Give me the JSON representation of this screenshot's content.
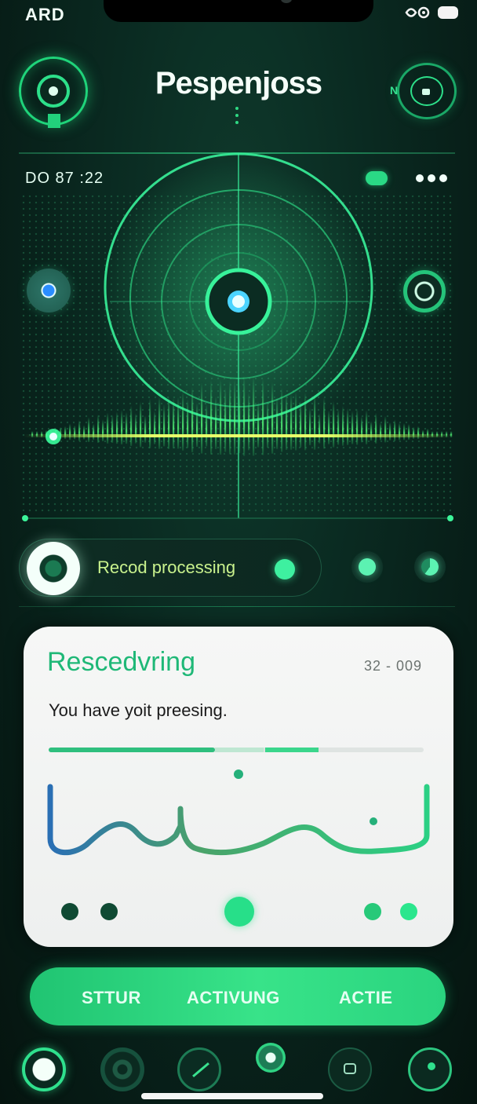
{
  "status_bar": {
    "left_text": "ARD",
    "icons": [
      "signal-icon",
      "location-icon",
      "battery-icon"
    ]
  },
  "header": {
    "title": "Pespenjoss",
    "left_icon": "record-ring-icon",
    "right_icon": "camera-ring-icon",
    "right_icon_letter": "N"
  },
  "visualizer": {
    "time": "DO 87 :22",
    "badge_icon": "pill-icon",
    "more_icon": "more-dots-icon",
    "left_orb_icon": "orb-icon",
    "right_orb_icon": "target-icon"
  },
  "processing": {
    "label": "Recod processing",
    "chips": [
      "status-chip-icon",
      "progress-chip-icon"
    ]
  },
  "card": {
    "title": "Rescedvring",
    "time": "32 - 009",
    "message": "You have yoit preesing.",
    "progress_segments": [
      0.35,
      0.11,
      0.11
    ]
  },
  "actions": [
    "STTUR",
    "ACTIVUNG",
    "ACTIE"
  ],
  "bottom_nav": [
    "home-ring-icon",
    "speaker-icon",
    "radar-icon",
    "record-icon",
    "chat-icon",
    "profile-ring-icon"
  ],
  "colors": {
    "accent": "#2fe08d",
    "background": "#0a2a21",
    "card": "#f6f7f6",
    "title_green": "#1fb877",
    "processing_text": "#c9f28d"
  }
}
